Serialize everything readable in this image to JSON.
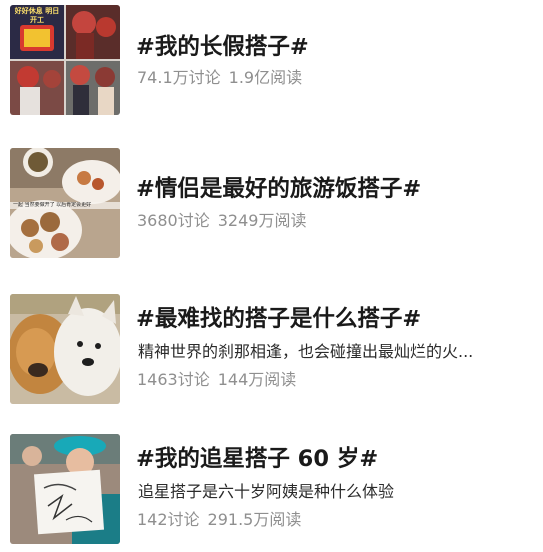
{
  "topics": [
    {
      "title": "#我的长假搭子#",
      "description": "",
      "discussions": "74.1万讨论",
      "reads": "1.9亿阅读",
      "thumb_text": "好好休息 明日开工"
    },
    {
      "title": "#情侣是最好的旅游饭搭子#",
      "description": "",
      "discussions": "3680讨论",
      "reads": "3249万阅读",
      "thumb_text": "一起 当然要做开了 以后肯定会更好"
    },
    {
      "title": "#最难找的搭子是什么搭子#",
      "description": "精神世界的刹那相逢，也会碰撞出最灿烂的火...",
      "discussions": "1463讨论",
      "reads": "144万阅读",
      "thumb_text": ""
    },
    {
      "title": "#我的追星搭子 60 岁#",
      "description": "追星搭子是六十岁阿姨是种什么体验",
      "discussions": "142讨论",
      "reads": "291.5万阅读",
      "thumb_text": ""
    }
  ],
  "colors": {
    "title": "#1a1a1a",
    "description": "#2b2b2b",
    "stats": "#8f8f8f"
  }
}
